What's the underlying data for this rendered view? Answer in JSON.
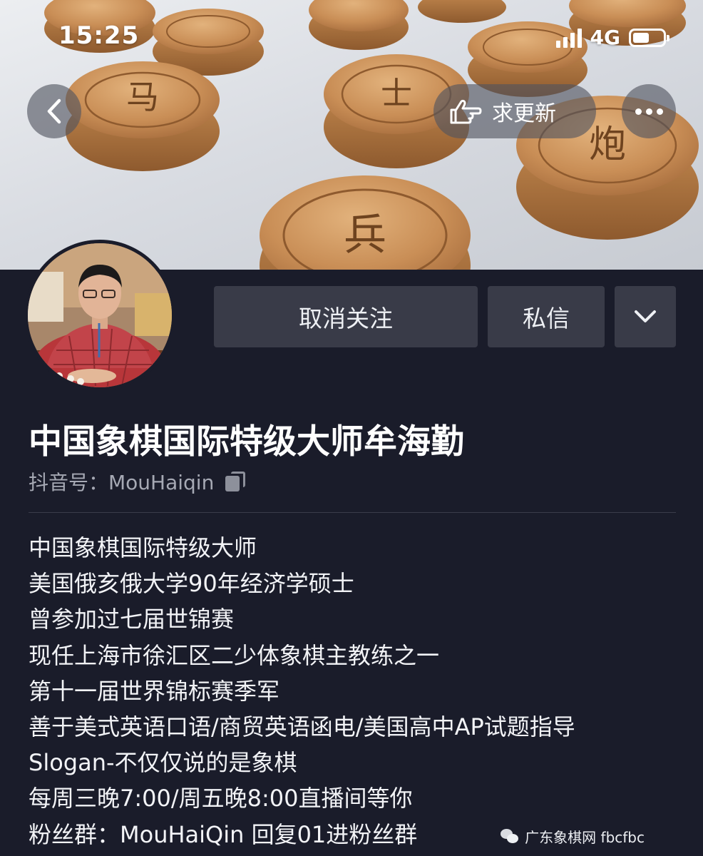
{
  "status_bar": {
    "time": "15:25",
    "network": "4G",
    "battery_level": 0.55
  },
  "cover": {
    "piece_glyphs": [
      "马",
      "士",
      "炮",
      "兵"
    ]
  },
  "header": {
    "request_update_label": "求更新"
  },
  "actions": {
    "unfollow_label": "取消关注",
    "message_label": "私信"
  },
  "profile": {
    "display_name": "中国象棋国际特级大师牟海勤",
    "douyin_id": "抖音号：MouHaiqin",
    "bio": [
      "中国象棋国际特级大师",
      "美国俄亥俄大学90年经济学硕士",
      "曾参加过七届世锦赛",
      "现任上海市徐汇区二少体象棋主教练之一",
      "第十一届世界锦标赛季军",
      "善于美式英语口语/商贸英语函电/美国高中AP试题指导",
      "Slogan-不仅仅说的是象棋",
      "每周三晚7:00/周五晚8:00直播间等你",
      "粉丝群：MouHaiQin 回复01进粉丝群"
    ]
  },
  "watermark": {
    "text": "广东象棋网 fbcfbc"
  },
  "icons": {
    "back": "chevron-left-icon",
    "request_update": "hand-pointing-icon",
    "more": "more-horizontal-icon",
    "expand": "chevron-down-icon",
    "copy": "copy-icon",
    "watermark": "wechat-icon"
  }
}
